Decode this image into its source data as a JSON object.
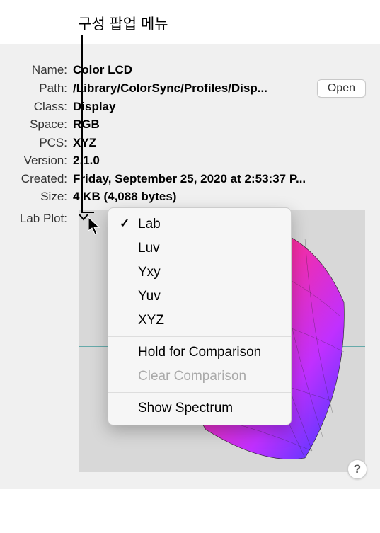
{
  "annotation": {
    "label": "구성 팝업 메뉴"
  },
  "fields": {
    "name_label": "Name:",
    "name_value": "Color LCD",
    "path_label": "Path:",
    "path_value": "/Library/ColorSync/Profiles/Disp...",
    "open_label": "Open",
    "class_label": "Class:",
    "class_value": "Display",
    "space_label": "Space:",
    "space_value": "RGB",
    "pcs_label": "PCS:",
    "pcs_value": "XYZ",
    "version_label": "Version:",
    "version_value": "2.1.0",
    "created_label": "Created:",
    "created_value": "Friday, September 25, 2020 at 2:53:37 P...",
    "size_label": "Size:",
    "size_value": "4 KB (4,088 bytes)",
    "labplot_label": "Lab Plot:"
  },
  "menu": {
    "items": [
      {
        "label": "Lab",
        "checked": true,
        "disabled": false
      },
      {
        "label": "Luv",
        "checked": false,
        "disabled": false
      },
      {
        "label": "Yxy",
        "checked": false,
        "disabled": false
      },
      {
        "label": "Yuv",
        "checked": false,
        "disabled": false
      },
      {
        "label": "XYZ",
        "checked": false,
        "disabled": false
      }
    ],
    "hold_label": "Hold for Comparison",
    "clear_label": "Clear Comparison",
    "spectrum_label": "Show Spectrum"
  },
  "help": {
    "label": "?"
  }
}
